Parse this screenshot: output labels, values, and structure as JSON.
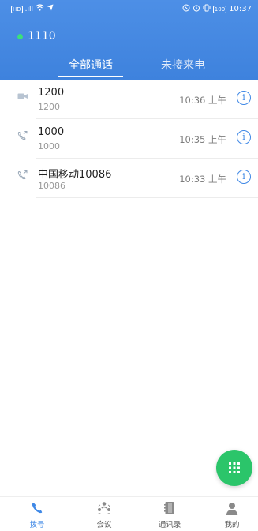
{
  "status_bar": {
    "left_glyphs": "ᴴᴰ⁴⁶.ıll",
    "time": "10:37",
    "battery": "100"
  },
  "account": {
    "number": "1110",
    "status_color": "#3be07a"
  },
  "tabs": [
    {
      "label": "全部通话",
      "active": true
    },
    {
      "label": "未接来电",
      "active": false
    }
  ],
  "calls": [
    {
      "name": "1200",
      "number": "1200",
      "time": "10:36 上午",
      "type_icon": "video-call-icon"
    },
    {
      "name": "1000",
      "number": "1000",
      "time": "10:35 上午",
      "type_icon": "outgoing-call-icon"
    },
    {
      "name": "中国移动10086",
      "number": "10086",
      "time": "10:33 上午",
      "type_icon": "outgoing-call-icon"
    }
  ],
  "info_glyph": "i",
  "bottom_nav": {
    "dial": "拨号",
    "meeting": "会议",
    "contacts": "通讯录",
    "me": "我的"
  },
  "colors": {
    "header": "#3e82dd",
    "accent": "#3f88e6",
    "fab": "#2bc56a"
  }
}
